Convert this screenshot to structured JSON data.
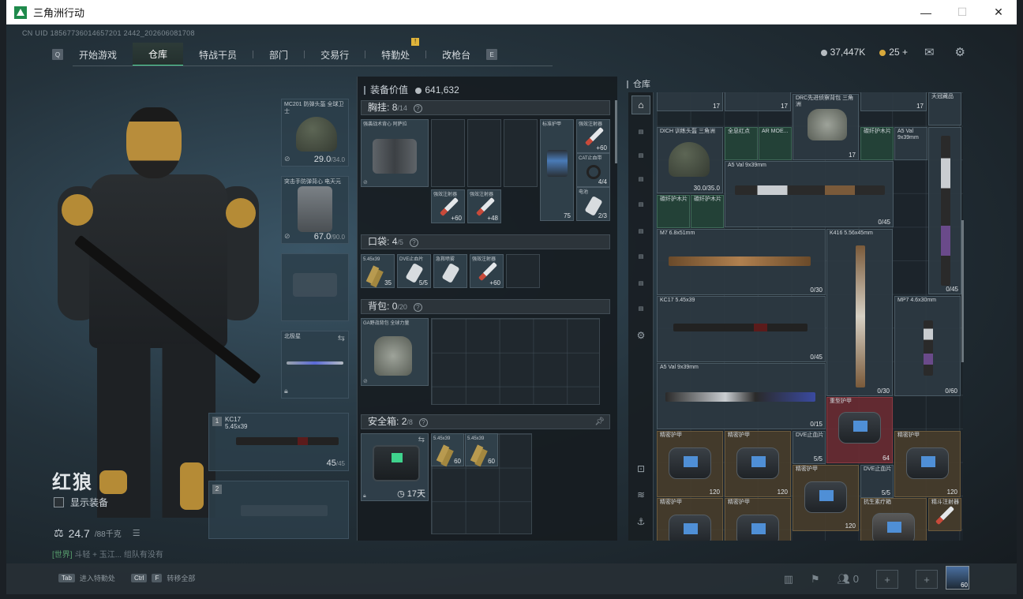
{
  "window": {
    "title": "三角洲行动",
    "minimize": "—",
    "maximize": "☐",
    "close": "✕"
  },
  "uid": "CN UID 18567736014657201 2442_202606081708",
  "nav": {
    "left_key": "Q",
    "right_key": "E",
    "tabs": [
      "开始游戏",
      "仓库",
      "特战干员",
      "部门",
      "交易行",
      "特勤处",
      "改枪台"
    ],
    "active_tab": "仓库",
    "badge": "!"
  },
  "currency": {
    "silver": "37,447K",
    "gold": "25",
    "gold_add": "+"
  },
  "icons": {
    "mail": "mail-icon",
    "settings": "gear-icon"
  },
  "operator": {
    "name": "红狼",
    "show_equipment": "显示装备",
    "weight": "24.7",
    "weight_max": "/88千克",
    "chat_channel": "[世界]",
    "chat_text": "斗轻 + 玉江... 组队有没有"
  },
  "equipment": {
    "helmet": {
      "name": "MC201 防弹头盔 全球卫士",
      "durability": "29.0",
      "durability_max": "/34.0"
    },
    "armor": {
      "name": "突击手防弹背心 电天元",
      "durability": "67.0",
      "durability_max": "/90.0"
    },
    "melee": {
      "name": "北极星"
    },
    "primary1": {
      "slot": "1",
      "name": "KC17",
      "caliber": "5.45x39",
      "ammo": "45",
      "ammo_max": "/45"
    },
    "primary2": {
      "slot": "2"
    }
  },
  "loadout": {
    "equip_value_label": "装备价值",
    "equip_value": "641,632",
    "chest_rig": {
      "label": "胸挂:",
      "count": "8",
      "capacity": "/14",
      "help": "?"
    },
    "pockets": {
      "label": "口袋:",
      "count": "4",
      "capacity": "/5",
      "help": "?"
    },
    "backpack": {
      "label": "背包:",
      "count": "0",
      "capacity": "/20",
      "help": "?"
    },
    "safe_box": {
      "label": "安全箱:",
      "count": "2",
      "capacity": "/8",
      "help": "?",
      "time": "17天"
    },
    "rig_item": "强袭战术背心 阿萨拉",
    "rig_cells": [
      {
        "name": "标准护甲",
        "val": "75"
      },
      {
        "name": "强效注射器",
        "val": "+60"
      },
      {
        "name": "CAT止血带",
        "val": "4/4"
      },
      {
        "name": "电池",
        "val": "2/3"
      },
      {
        "name": "强效注射器",
        "val": "+60"
      },
      {
        "name": "强效注射器",
        "val": "+48"
      }
    ],
    "pocket_cells": [
      {
        "name": "5.45x39",
        "val": "35"
      },
      {
        "name": "DVE止血片",
        "val": "5/5"
      },
      {
        "name": "急救喷雾",
        "val": ""
      },
      {
        "name": "强效注射器",
        "val": "+60"
      }
    ],
    "backpack_item": "GA野战背包 全球力量",
    "safe_cells": [
      {
        "name": "5.45x39",
        "val": "60"
      },
      {
        "name": "5.45x39",
        "val": "60"
      }
    ]
  },
  "storage": {
    "title": "仓库",
    "items": [
      {
        "name": "DICH 训练头盔 三角洲",
        "val": "30.0/35.0"
      },
      {
        "name": "全息红点",
        "val": ""
      },
      {
        "name": "AR MOE...",
        "val": ""
      },
      {
        "name": "DRC先进侦察背包 三角洲",
        "val": "17"
      },
      {
        "name": "A5 Val 9x39mm",
        "val": "0/45"
      },
      {
        "name": "A5 Val 9x39mm",
        "val": "0/45"
      },
      {
        "name": "碳纤护木片",
        "val": ""
      },
      {
        "name": "碳纤护木片",
        "val": ""
      },
      {
        "name": "碳纤护木片",
        "val": ""
      },
      {
        "name": "M7 6.8x51mm",
        "val": "0/30"
      },
      {
        "name": "K416 5.56x45mm",
        "val": "0/30"
      },
      {
        "name": "KC17 5.45x39",
        "val": "0/45"
      },
      {
        "name": "MP7 4.6x30mm",
        "val": "0/60"
      },
      {
        "name": "A5 Val 9x39mm",
        "val": "0/15"
      },
      {
        "name": "重型护甲",
        "val": "64"
      },
      {
        "name": "精密护甲",
        "val": "120"
      },
      {
        "name": "精密护甲",
        "val": "120"
      },
      {
        "name": "DVE止血片",
        "val": "5/5"
      },
      {
        "name": "精密护甲",
        "val": "120"
      },
      {
        "name": "精密护甲",
        "val": "120"
      },
      {
        "name": "DVE止血片",
        "val": "5/5"
      },
      {
        "name": "精密护甲",
        "val": "120"
      },
      {
        "name": "精密护甲",
        "val": ""
      },
      {
        "name": "抗生素疗箱",
        "val": ""
      },
      {
        "name": "精斗注射器",
        "val": ""
      }
    ],
    "top_counts": [
      "17",
      "17",
      "17"
    ],
    "top_label": "天冠藏品"
  },
  "bottom": {
    "hint1_key": "Tab",
    "hint1": "进入特勤处",
    "hint2_key": "Ctrl",
    "hint2_key2": "F",
    "hint2": "转移全部",
    "friends": "0",
    "level": "60"
  }
}
